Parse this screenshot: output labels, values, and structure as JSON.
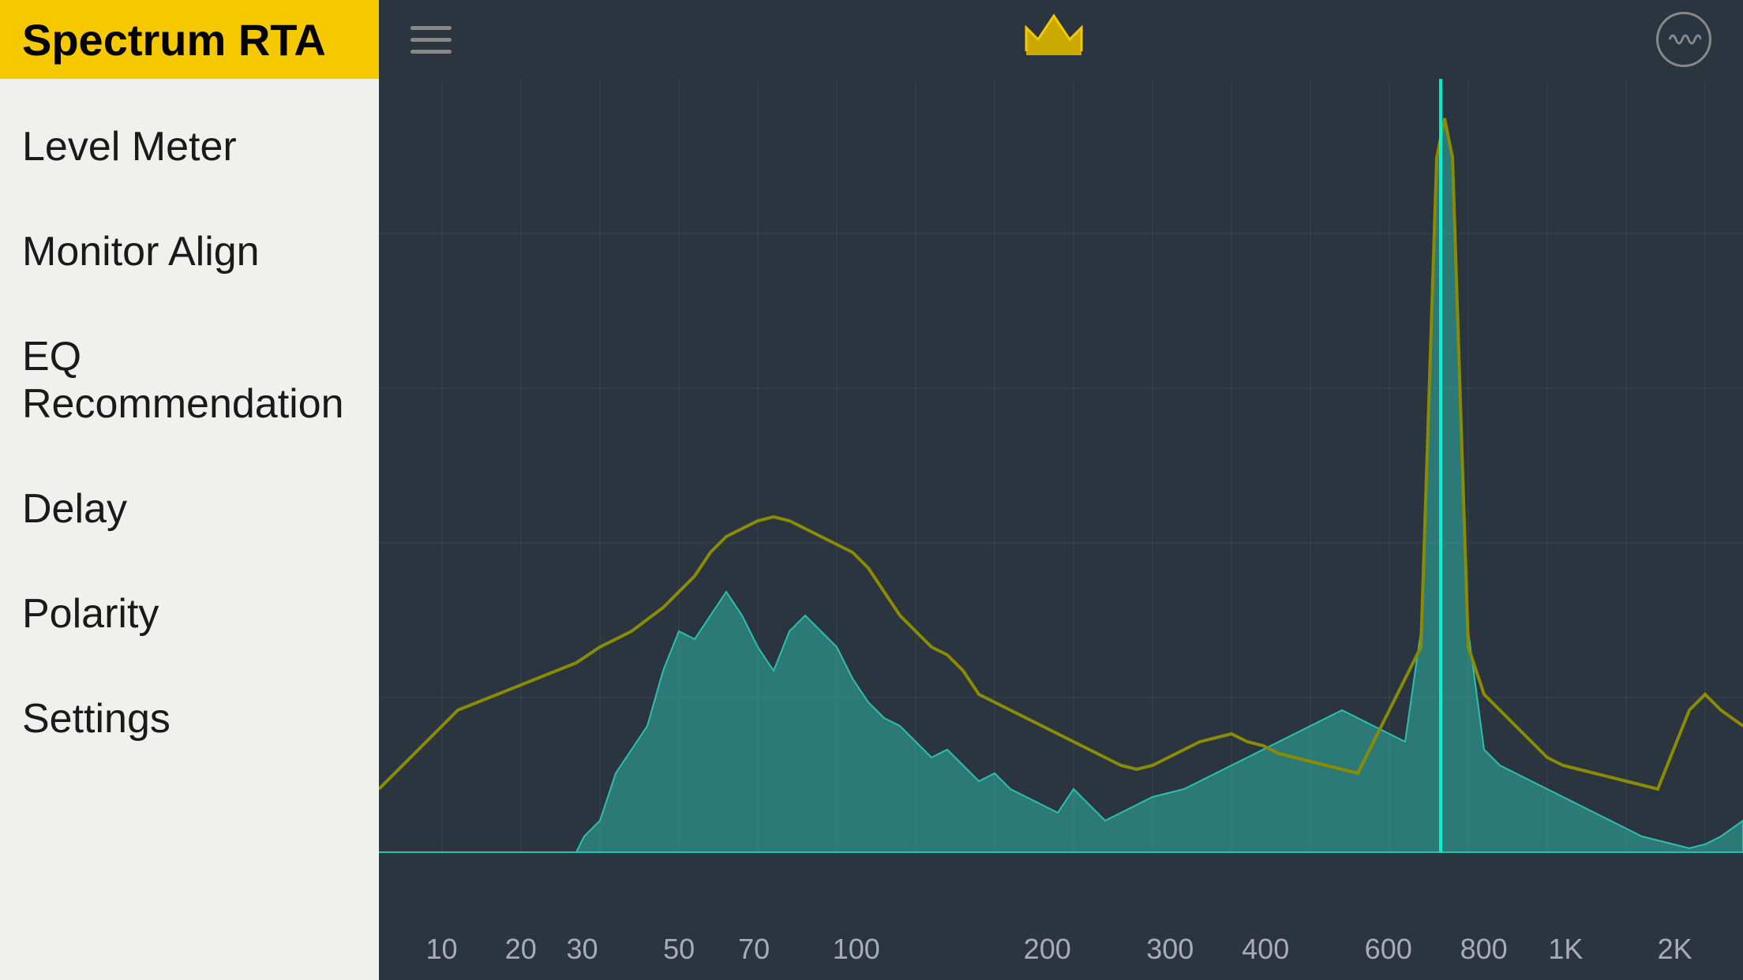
{
  "sidebar": {
    "title": "Spectrum RTA",
    "items": [
      {
        "label": "Level Meter",
        "id": "level-meter"
      },
      {
        "label": "Monitor Align",
        "id": "monitor-align"
      },
      {
        "label": "EQ Recommendation",
        "id": "eq-recommendation"
      },
      {
        "label": "Delay",
        "id": "delay"
      },
      {
        "label": "Polarity",
        "id": "polarity"
      },
      {
        "label": "Settings",
        "id": "settings"
      }
    ]
  },
  "toolbar": {
    "menu_icon": "hamburger-menu",
    "crown_icon": "crown",
    "waveform_icon": "waveform-circle"
  },
  "chart": {
    "x_labels": [
      "10",
      "20",
      "30",
      "50",
      "70",
      "100",
      "200",
      "300",
      "400",
      "600",
      "800",
      "1K",
      "2K"
    ],
    "colors": {
      "yellow_line": "#8B8B00",
      "teal_fill": "#2dbfad",
      "spike": "#00ffcc",
      "background": "#2a3540"
    }
  }
}
